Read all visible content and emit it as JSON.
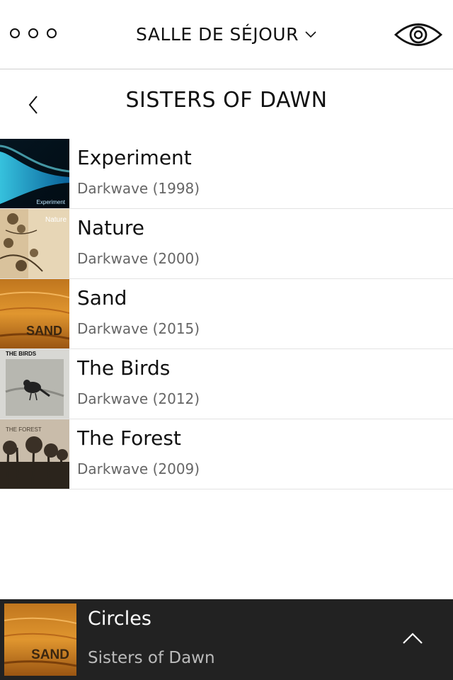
{
  "topbar": {
    "menu_icon": "more-dots-icon",
    "room_label": "SALLE DE SÉJOUR",
    "room_chevron_icon": "chevron-down-icon",
    "view_icon": "eye-icon"
  },
  "header": {
    "back_icon": "chevron-left-icon",
    "title": "SISTERS OF DAWN"
  },
  "albums": [
    {
      "title": "Experiment",
      "subtitle": "Darkwave (1998)",
      "cover_text": "Experiment"
    },
    {
      "title": "Nature",
      "subtitle": "Darkwave (2000)",
      "cover_text": "Nature"
    },
    {
      "title": "Sand",
      "subtitle": "Darkwave (2015)",
      "cover_text": "SAND"
    },
    {
      "title": "The Birds",
      "subtitle": "Darkwave (2012)",
      "cover_text": "THE BIRDS"
    },
    {
      "title": "The Forest",
      "subtitle": "Darkwave (2009)",
      "cover_text": "THE FOREST"
    }
  ],
  "now_playing": {
    "track": "Circles",
    "artist": "Sisters of Dawn",
    "cover_text": "SAND",
    "expand_icon": "chevron-up-icon"
  },
  "colors": {
    "now_playing_bg": "#222222",
    "divider": "#e3e3e3",
    "subtitle_text": "#666666"
  }
}
